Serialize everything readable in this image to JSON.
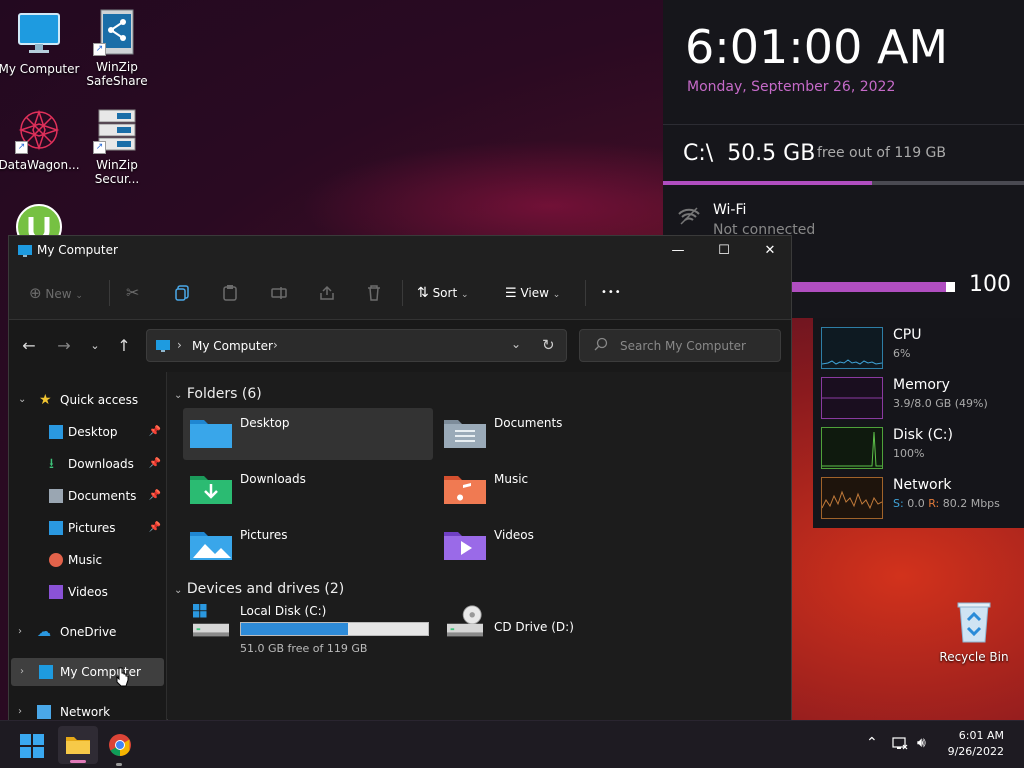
{
  "desktop": {
    "icons": [
      {
        "label": "My Computer"
      },
      {
        "label": "WinZip SafeShare"
      },
      {
        "label": "DataWagon..."
      },
      {
        "label": "WinZip Secur..."
      },
      {
        "label": "Recycle Bin"
      }
    ]
  },
  "widgets": {
    "clock": "6:01:00 AM",
    "date": "Monday, September 26, 2022",
    "disk_drive": "C:\\",
    "disk_free": "50.5 GB",
    "disk_sub": "free out of 119 GB",
    "disk_used_fraction": 0.58,
    "wifi_title": "Wi-Fi",
    "wifi_status": "Not connected",
    "volume": "100",
    "volume_fraction": 0.95,
    "perf": {
      "cpu_name": "CPU",
      "cpu_val": "6%",
      "mem_name": "Memory",
      "mem_val": "3.9/8.0 GB (49%)",
      "disk_name": "Disk (C:)",
      "disk_val": "100%",
      "net_name": "Network",
      "net_s_label": "S:",
      "net_s_val": "0.0",
      "net_r_label": "R:",
      "net_r_val": "80.2 Mbps"
    }
  },
  "window": {
    "title": "My Computer",
    "toolbar": {
      "new": "New",
      "sort": "Sort",
      "view": "View",
      "more": "•••"
    },
    "address": {
      "crumb": "My Computer",
      "search_placeholder": "Search My Computer"
    },
    "nav": {
      "quick_access": "Quick access",
      "items": [
        "Desktop",
        "Downloads",
        "Documents",
        "Pictures",
        "Music",
        "Videos"
      ],
      "onedrive": "OneDrive",
      "mycomputer": "My Computer",
      "network": "Network"
    },
    "content": {
      "folders_header": "Folders (6)",
      "folders": [
        "Desktop",
        "Documents",
        "Downloads",
        "Music",
        "Pictures",
        "Videos"
      ],
      "drives_header": "Devices and drives (2)",
      "local_disk": "Local Disk (C:)",
      "local_disk_free": "51.0 GB free of 119 GB",
      "local_disk_used_fraction": 0.57,
      "cd_drive": "CD Drive (D:)"
    }
  },
  "taskbar": {
    "time": "6:01 AM",
    "date": "9/26/2022"
  },
  "colors": {
    "accent_purple": "#b04ec0",
    "date_purple": "#c56ac8",
    "drive_bar": "#2e8bd8"
  }
}
